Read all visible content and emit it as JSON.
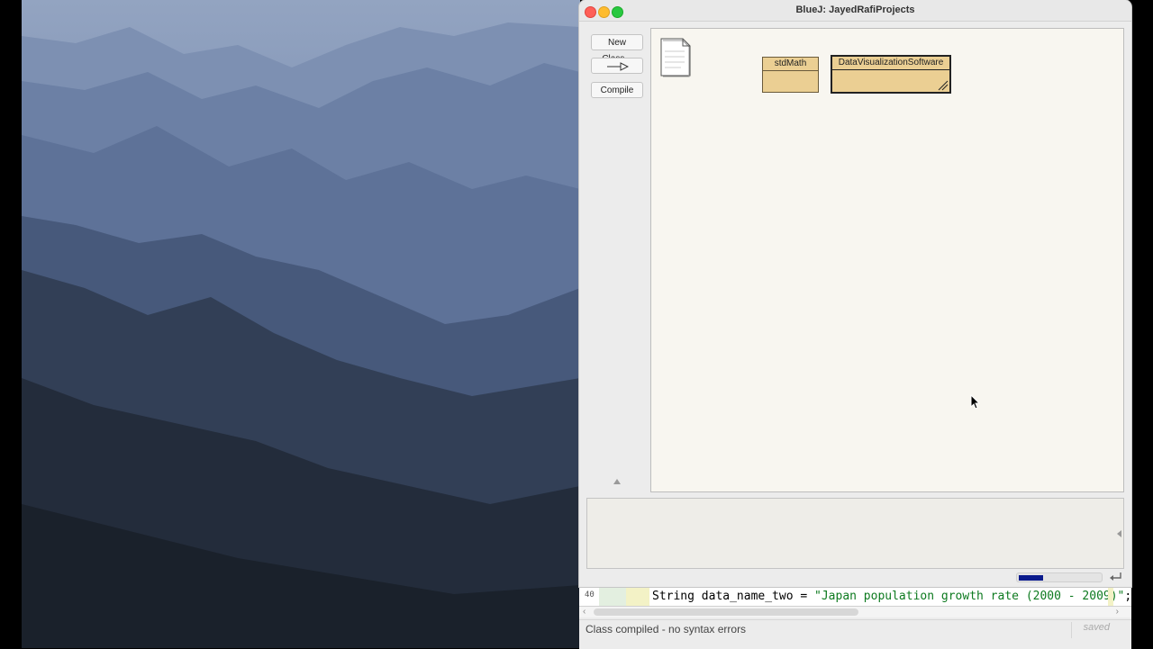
{
  "window": {
    "title": "BlueJ:  JayedRafiProjects"
  },
  "toolbar": {
    "new_class_label": "New Class...",
    "arrow_icon": "uses-arrow-icon",
    "compile_label": "Compile"
  },
  "diagram": {
    "readme_icon": "document-icon",
    "classes": [
      {
        "name": "stdMath",
        "selected": false
      },
      {
        "name": "DataVisualizationSoftware",
        "selected": true
      }
    ]
  },
  "terminal": {
    "progress": 0.3
  },
  "editor": {
    "line_number": "40",
    "code_prefix": "String data_name_two = ",
    "code_string": "\"Japan population growth rate (2000 - 2009)\"",
    "code_suffix": ";",
    "status_message": "Class compiled - no syntax errors",
    "saved_label": "saved"
  },
  "colors": {
    "class_fill": "#ebcf93",
    "diagram_bg": "#f8f6f0",
    "progress_fill": "#0a1a8c",
    "string_literal": "#0d7a1f"
  }
}
